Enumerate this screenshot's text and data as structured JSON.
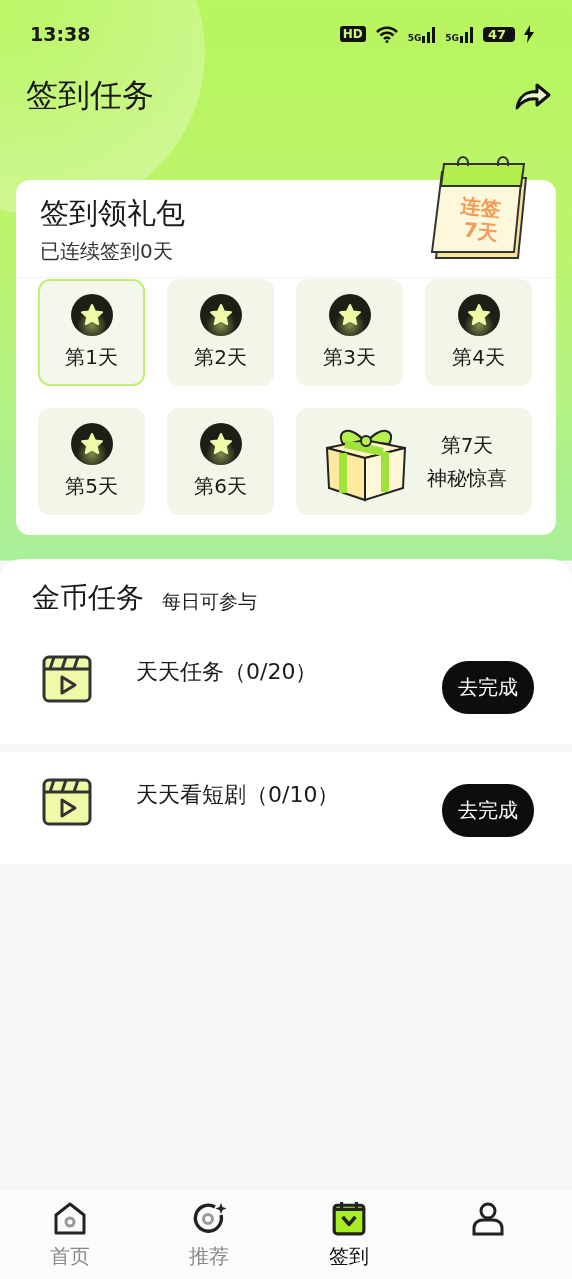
{
  "status_bar": {
    "time": "13:38",
    "indicators": [
      "HD",
      "5G",
      "5G"
    ],
    "battery": "47"
  },
  "header": {
    "title": "签到任务"
  },
  "signin": {
    "title": "签到领礼包",
    "subtitle": "已连续签到0天",
    "calendar_badge": [
      "连签",
      "7天"
    ],
    "days": [
      {
        "kind": "star",
        "label": "第1天",
        "selected": true
      },
      {
        "kind": "star",
        "label": "第2天",
        "selected": false
      },
      {
        "kind": "star",
        "label": "第3天",
        "selected": false
      },
      {
        "kind": "star",
        "label": "第4天",
        "selected": false
      },
      {
        "kind": "star",
        "label": "第5天",
        "selected": false
      },
      {
        "kind": "star",
        "label": "第6天",
        "selected": false
      },
      {
        "kind": "gift",
        "label": "第7天",
        "subtitle": "神秘惊喜",
        "selected": false
      }
    ]
  },
  "coin_tasks": {
    "title": "金币任务",
    "subtitle": "每日可参与",
    "tasks": [
      {
        "title": "天天任务（0/20）",
        "button": "去完成"
      },
      {
        "title": "天天看短剧（0/10）",
        "button": "去完成"
      }
    ]
  },
  "bottom_nav": [
    {
      "kind": "home",
      "label": "首页",
      "selected": false
    },
    {
      "kind": "discover",
      "label": "推荐",
      "selected": false
    },
    {
      "kind": "checkin",
      "label": "签到",
      "selected": true
    },
    {
      "kind": "profile",
      "selected": false
    }
  ]
}
